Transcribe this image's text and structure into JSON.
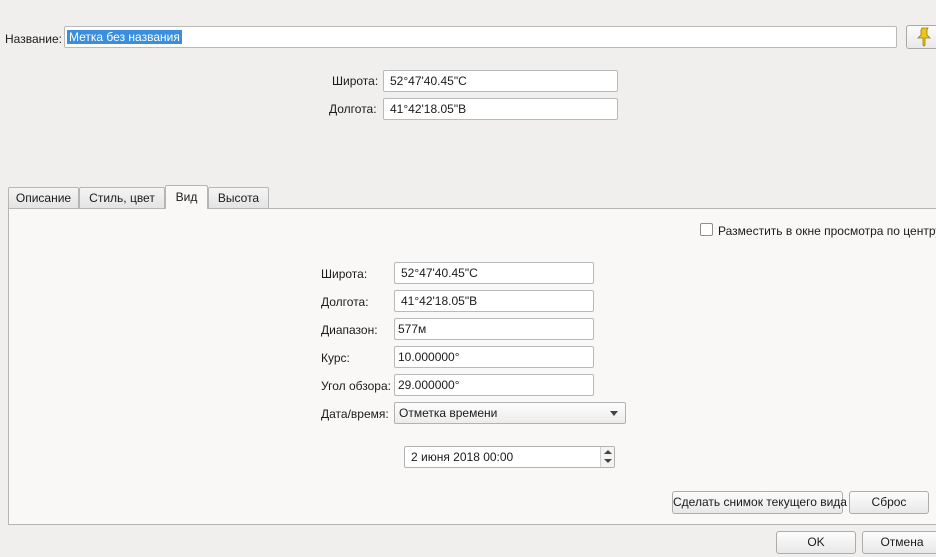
{
  "header": {
    "name_label": "Название:",
    "name_value": "Метка без названия",
    "pin_icon": "pushpin-icon",
    "latitude_label": "Широта:",
    "latitude_value": "52°47'40.45\"С",
    "longitude_label": "Долгота:",
    "longitude_value": "41°42'18.05\"В"
  },
  "tabs": [
    {
      "label": "Описание"
    },
    {
      "label": "Стиль, цвет"
    },
    {
      "label": "Вид"
    },
    {
      "label": "Высота"
    }
  ],
  "view": {
    "center_checkbox_label": "Разместить в окне просмотра по центру",
    "center_checked": false,
    "latitude_label": "Широта:",
    "latitude_value": "52°47'40.45\"С",
    "longitude_label": "Долгота:",
    "longitude_value": "41°42'18.05\"В",
    "range_label": "Диапазон:",
    "range_value": "577м",
    "heading_label": "Курс:",
    "heading_value": "10.000000°",
    "tilt_label": "Угол обзора:",
    "tilt_value": "29.000000°",
    "datetime_label": "Дата/время:",
    "datetime_mode": "Отметка времени",
    "datetime_value": "2 июня 2018 00:00",
    "snapshot_button": "Сделать снимок текущего вида",
    "reset_button": "Сброс"
  },
  "footer": {
    "ok_button": "OK",
    "cancel_button": "Отмена"
  },
  "colors": {
    "selection": "#3b8ede",
    "pin": "#e9c619"
  }
}
